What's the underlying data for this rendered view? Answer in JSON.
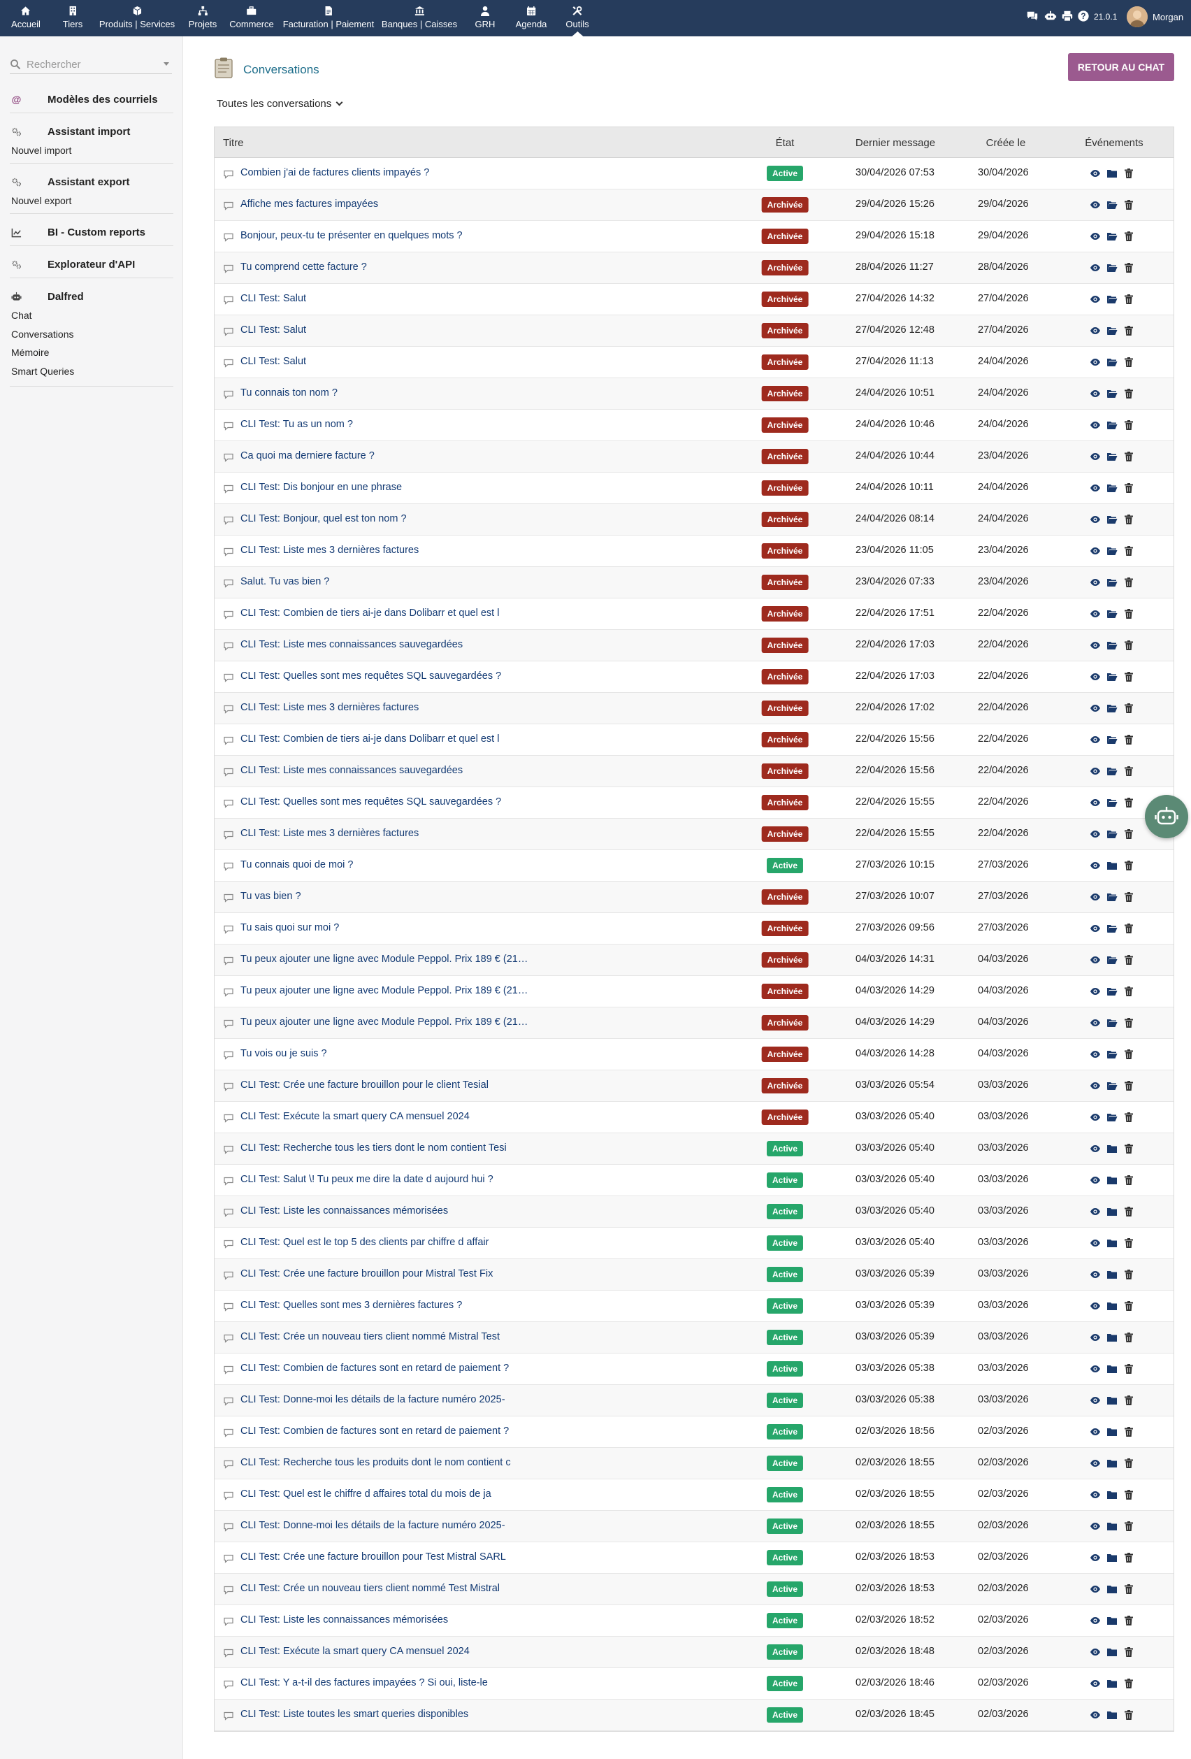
{
  "topbar": {
    "menu": [
      {
        "label": "Accueil",
        "icon": "home-icon"
      },
      {
        "label": "Tiers",
        "icon": "building-icon"
      },
      {
        "label": "Produits | Services",
        "icon": "cube-icon"
      },
      {
        "label": "Projets",
        "icon": "sitemap-icon"
      },
      {
        "label": "Commerce",
        "icon": "briefcase-icon"
      },
      {
        "label": "Facturation | Paiement",
        "icon": "invoice-icon"
      },
      {
        "label": "Banques | Caisses",
        "icon": "bank-icon"
      },
      {
        "label": "GRH",
        "icon": "user-tie-icon"
      },
      {
        "label": "Agenda",
        "icon": "calendar-icon"
      },
      {
        "label": "Outils",
        "icon": "tools-icon"
      }
    ],
    "active_menu": "Outils",
    "right_icons": [
      "chat-icon",
      "robot-icon",
      "print-icon",
      "help-icon"
    ],
    "version": "21.0.1",
    "user": "Morgan"
  },
  "sidebar": {
    "search_placeholder": "Rechercher",
    "sections": [
      {
        "title": "Modèles des courriels",
        "icon": "at-icon",
        "items": []
      },
      {
        "title": "Assistant import",
        "icon": "cogs-icon",
        "items": [
          "Nouvel import"
        ]
      },
      {
        "title": "Assistant export",
        "icon": "cogs-icon",
        "items": [
          "Nouvel export"
        ]
      },
      {
        "title": "BI - Custom reports",
        "icon": "chart-line-icon",
        "items": []
      },
      {
        "title": "Explorateur d'API",
        "icon": "cogs-icon",
        "items": []
      },
      {
        "title": "Dalfred",
        "icon": "robot-icon",
        "items": [
          "Chat",
          "Conversations",
          "Mémoire",
          "Smart Queries"
        ]
      }
    ]
  },
  "page": {
    "title": "Conversations",
    "back_button": "RETOUR AU CHAT",
    "filter": "Toutes les conversations"
  },
  "table": {
    "headers": {
      "title": "Titre",
      "state": "État",
      "last": "Dernier message",
      "created": "Créée le",
      "events": "Événements"
    },
    "labels": {
      "active": "Active",
      "archived": "Archivée"
    },
    "rows": [
      {
        "title": "Combien j'ai de factures clients impayés ?",
        "status": "Active",
        "last": "30/04/2026 07:53",
        "created": "30/04/2026"
      },
      {
        "title": "Affiche mes factures impayées",
        "status": "Archivée",
        "last": "29/04/2026 15:26",
        "created": "29/04/2026"
      },
      {
        "title": "Bonjour, peux-tu te présenter en quelques mots ?",
        "status": "Archivée",
        "last": "29/04/2026 15:18",
        "created": "29/04/2026"
      },
      {
        "title": "Tu comprend cette facture ?",
        "status": "Archivée",
        "last": "28/04/2026 11:27",
        "created": "28/04/2026"
      },
      {
        "title": "CLI Test: Salut",
        "status": "Archivée",
        "last": "27/04/2026 14:32",
        "created": "27/04/2026"
      },
      {
        "title": "CLI Test: Salut",
        "status": "Archivée",
        "last": "27/04/2026 12:48",
        "created": "27/04/2026"
      },
      {
        "title": "CLI Test: Salut",
        "status": "Archivée",
        "last": "27/04/2026 11:13",
        "created": "24/04/2026"
      },
      {
        "title": "Tu connais ton nom ?",
        "status": "Archivée",
        "last": "24/04/2026 10:51",
        "created": "24/04/2026"
      },
      {
        "title": "CLI Test: Tu as un nom ?",
        "status": "Archivée",
        "last": "24/04/2026 10:46",
        "created": "24/04/2026"
      },
      {
        "title": "Ca quoi ma derniere facture ?",
        "status": "Archivée",
        "last": "24/04/2026 10:44",
        "created": "23/04/2026"
      },
      {
        "title": "CLI Test: Dis bonjour en une phrase",
        "status": "Archivée",
        "last": "24/04/2026 10:11",
        "created": "24/04/2026"
      },
      {
        "title": "CLI Test: Bonjour, quel est ton nom ?",
        "status": "Archivée",
        "last": "24/04/2026 08:14",
        "created": "24/04/2026"
      },
      {
        "title": "CLI Test: Liste mes 3 dernières factures",
        "status": "Archivée",
        "last": "23/04/2026 11:05",
        "created": "23/04/2026"
      },
      {
        "title": "Salut. Tu vas bien ?",
        "status": "Archivée",
        "last": "23/04/2026 07:33",
        "created": "23/04/2026"
      },
      {
        "title": "CLI Test: Combien de tiers ai-je dans Dolibarr et quel est l",
        "status": "Archivée",
        "last": "22/04/2026 17:51",
        "created": "22/04/2026"
      },
      {
        "title": "CLI Test: Liste mes connaissances sauvegardées",
        "status": "Archivée",
        "last": "22/04/2026 17:03",
        "created": "22/04/2026"
      },
      {
        "title": "CLI Test: Quelles sont mes requêtes SQL sauvegardées ?",
        "status": "Archivée",
        "last": "22/04/2026 17:03",
        "created": "22/04/2026"
      },
      {
        "title": "CLI Test: Liste mes 3 dernières factures",
        "status": "Archivée",
        "last": "22/04/2026 17:02",
        "created": "22/04/2026"
      },
      {
        "title": "CLI Test: Combien de tiers ai-je dans Dolibarr et quel est l",
        "status": "Archivée",
        "last": "22/04/2026 15:56",
        "created": "22/04/2026"
      },
      {
        "title": "CLI Test: Liste mes connaissances sauvegardées",
        "status": "Archivée",
        "last": "22/04/2026 15:56",
        "created": "22/04/2026"
      },
      {
        "title": "CLI Test: Quelles sont mes requêtes SQL sauvegardées ?",
        "status": "Archivée",
        "last": "22/04/2026 15:55",
        "created": "22/04/2026"
      },
      {
        "title": "CLI Test: Liste mes 3 dernières factures",
        "status": "Archivée",
        "last": "22/04/2026 15:55",
        "created": "22/04/2026"
      },
      {
        "title": "Tu connais quoi de moi ?",
        "status": "Active",
        "last": "27/03/2026 10:15",
        "created": "27/03/2026"
      },
      {
        "title": "Tu vas bien ?",
        "status": "Archivée",
        "last": "27/03/2026 10:07",
        "created": "27/03/2026"
      },
      {
        "title": "Tu sais quoi sur moi ?",
        "status": "Archivée",
        "last": "27/03/2026 09:56",
        "created": "27/03/2026"
      },
      {
        "title": "Tu peux ajouter une ligne avec Module Peppol. Prix 189 € (21…",
        "status": "Archivée",
        "last": "04/03/2026 14:31",
        "created": "04/03/2026"
      },
      {
        "title": "Tu peux ajouter une ligne avec Module Peppol. Prix 189 € (21…",
        "status": "Archivée",
        "last": "04/03/2026 14:29",
        "created": "04/03/2026"
      },
      {
        "title": "Tu peux ajouter une ligne avec Module Peppol. Prix 189 € (21…",
        "status": "Archivée",
        "last": "04/03/2026 14:29",
        "created": "04/03/2026"
      },
      {
        "title": "Tu vois ou je suis ?",
        "status": "Archivée",
        "last": "04/03/2026 14:28",
        "created": "04/03/2026"
      },
      {
        "title": "CLI Test: Crée une facture brouillon pour le client Tesial",
        "status": "Archivée",
        "last": "03/03/2026 05:54",
        "created": "03/03/2026"
      },
      {
        "title": "CLI Test: Exécute la smart query CA mensuel 2024",
        "status": "Archivée",
        "last": "03/03/2026 05:40",
        "created": "03/03/2026"
      },
      {
        "title": "CLI Test: Recherche tous les tiers dont le nom contient Tesi",
        "status": "Active",
        "last": "03/03/2026 05:40",
        "created": "03/03/2026"
      },
      {
        "title": "CLI Test: Salut \\! Tu peux me dire la date d aujourd hui ?",
        "status": "Active",
        "last": "03/03/2026 05:40",
        "created": "03/03/2026"
      },
      {
        "title": "CLI Test: Liste les connaissances mémorisées",
        "status": "Active",
        "last": "03/03/2026 05:40",
        "created": "03/03/2026"
      },
      {
        "title": "CLI Test: Quel est le top 5 des clients par chiffre d affair",
        "status": "Active",
        "last": "03/03/2026 05:40",
        "created": "03/03/2026"
      },
      {
        "title": "CLI Test: Crée une facture brouillon pour Mistral Test Fix",
        "status": "Active",
        "last": "03/03/2026 05:39",
        "created": "03/03/2026"
      },
      {
        "title": "CLI Test: Quelles sont mes 3 dernières factures ?",
        "status": "Active",
        "last": "03/03/2026 05:39",
        "created": "03/03/2026"
      },
      {
        "title": "CLI Test: Crée un nouveau tiers client nommé Mistral Test",
        "status": "Active",
        "last": "03/03/2026 05:39",
        "created": "03/03/2026"
      },
      {
        "title": "CLI Test: Combien de factures sont en retard de paiement ?",
        "status": "Active",
        "last": "03/03/2026 05:38",
        "created": "03/03/2026"
      },
      {
        "title": "CLI Test: Donne-moi les détails de la facture numéro 2025-",
        "status": "Active",
        "last": "03/03/2026 05:38",
        "created": "03/03/2026"
      },
      {
        "title": "CLI Test: Combien de factures sont en retard de paiement ?",
        "status": "Active",
        "last": "02/03/2026 18:56",
        "created": "02/03/2026"
      },
      {
        "title": "CLI Test: Recherche tous les produits dont le nom contient c",
        "status": "Active",
        "last": "02/03/2026 18:55",
        "created": "02/03/2026"
      },
      {
        "title": "CLI Test: Quel est le chiffre d affaires total du mois de ja",
        "status": "Active",
        "last": "02/03/2026 18:55",
        "created": "02/03/2026"
      },
      {
        "title": "CLI Test: Donne-moi les détails de la facture numéro 2025-",
        "status": "Active",
        "last": "02/03/2026 18:55",
        "created": "02/03/2026"
      },
      {
        "title": "CLI Test: Crée une facture brouillon pour Test Mistral SARL",
        "status": "Active",
        "last": "02/03/2026 18:53",
        "created": "02/03/2026"
      },
      {
        "title": "CLI Test: Crée un nouveau tiers client nommé Test Mistral",
        "status": "Active",
        "last": "02/03/2026 18:53",
        "created": "02/03/2026"
      },
      {
        "title": "CLI Test: Liste les connaissances mémorisées",
        "status": "Active",
        "last": "02/03/2026 18:52",
        "created": "02/03/2026"
      },
      {
        "title": "CLI Test: Exécute la smart query CA mensuel 2024",
        "status": "Active",
        "last": "02/03/2026 18:48",
        "created": "02/03/2026"
      },
      {
        "title": "CLI Test: Y a-t-il des factures impayées ? Si oui, liste-le",
        "status": "Active",
        "last": "02/03/2026 18:46",
        "created": "02/03/2026"
      },
      {
        "title": "CLI Test: Liste toutes les smart queries disponibles",
        "status": "Active",
        "last": "02/03/2026 18:45",
        "created": "02/03/2026"
      }
    ]
  },
  "colors": {
    "topbar": "#263c5c",
    "active_badge": "#26a66a",
    "archived_badge": "#9e2a1e",
    "link": "#133a73",
    "title": "#1d6d8a",
    "button": "#9b5a8f",
    "fab": "#5b8a75"
  }
}
